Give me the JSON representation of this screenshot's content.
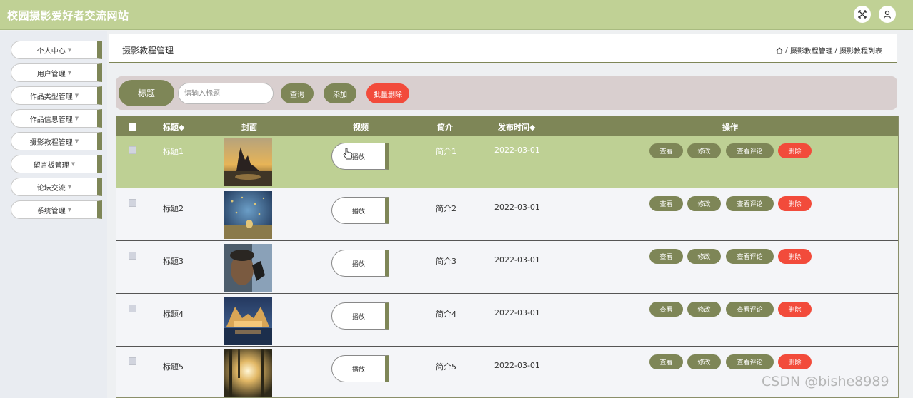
{
  "site": {
    "title": "校园摄影爱好者交流网站"
  },
  "topbar": {
    "fullscreen_icon": "fullscreen-icon",
    "user_icon": "user-icon"
  },
  "sidebar": {
    "items": [
      {
        "label": "个人中心"
      },
      {
        "label": "用户管理"
      },
      {
        "label": "作品类型管理"
      },
      {
        "label": "作品信息管理"
      },
      {
        "label": "摄影教程管理"
      },
      {
        "label": "留言板管理"
      },
      {
        "label": "论坛交流"
      },
      {
        "label": "系统管理"
      }
    ]
  },
  "header": {
    "title": "摄影教程管理",
    "breadcrumb": [
      "摄影教程管理",
      "摄影教程列表"
    ],
    "separator": "/"
  },
  "search": {
    "label": "标题",
    "placeholder": "请输入标题",
    "query_btn": "查询",
    "add_btn": "添加",
    "batch_delete_btn": "批量删除"
  },
  "table": {
    "columns": {
      "title": "标题◆",
      "cover": "封面",
      "video": "视频",
      "intro": "简介",
      "date": "发布时间◆",
      "actions": "操作"
    },
    "play_label": "播放",
    "actions": {
      "view": "查看",
      "edit": "修改",
      "comments": "查看评论",
      "delete": "删除"
    },
    "rows": [
      {
        "title": "标题1",
        "intro": "简介1",
        "date": "2022-03-01"
      },
      {
        "title": "标题2",
        "intro": "简介2",
        "date": "2022-03-01"
      },
      {
        "title": "标题3",
        "intro": "简介3",
        "date": "2022-03-01"
      },
      {
        "title": "标题4",
        "intro": "简介4",
        "date": "2022-03-01"
      },
      {
        "title": "标题5",
        "intro": "简介5",
        "date": "2022-03-01"
      }
    ]
  },
  "watermark": "CSDN @bishe8989",
  "colors": {
    "accent": "#7e8657",
    "topbar": "#c0d195",
    "selected_row": "#bed094",
    "danger": "#f24b3b",
    "search_bg": "#d9cfcf"
  }
}
